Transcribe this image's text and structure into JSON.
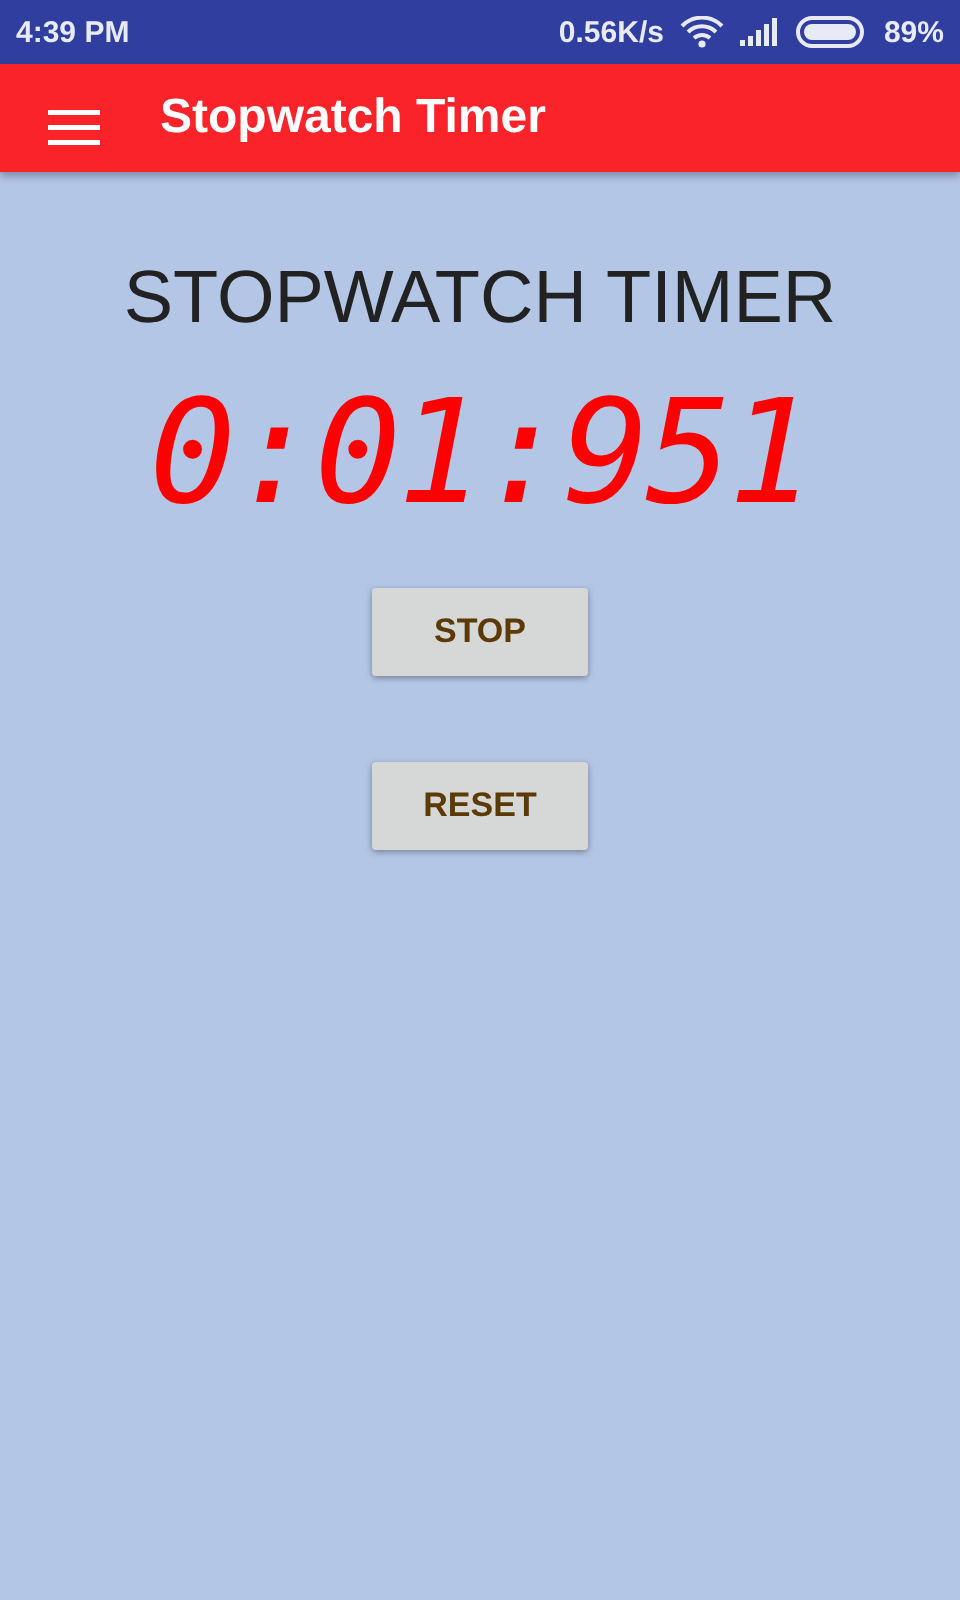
{
  "status_bar": {
    "time": "4:39 PM",
    "network_speed": "0.56K/s",
    "battery": "89%"
  },
  "app_bar": {
    "title": "Stopwatch Timer"
  },
  "heading": "STOPWATCH TIMER",
  "timer": "0:01:951",
  "buttons": [
    "STOP",
    "RESET"
  ]
}
